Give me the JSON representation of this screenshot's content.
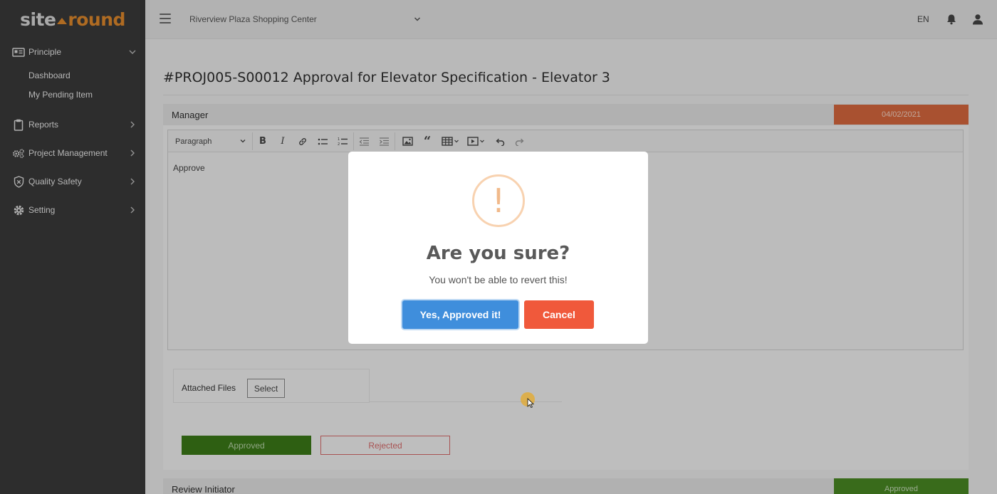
{
  "logo": {
    "part1": "site",
    "part2": "round"
  },
  "sidebar": {
    "principle": "Principle",
    "sub_items": [
      "Dashboard",
      "My Pending Item"
    ],
    "items": [
      {
        "label": "Reports",
        "icon": "clipboard-icon"
      },
      {
        "label": "Project Management",
        "icon": "gears-icon"
      },
      {
        "label": "Quality Safety",
        "icon": "shield-icon"
      },
      {
        "label": "Setting",
        "icon": "gear-icon"
      }
    ]
  },
  "topbar": {
    "project": "Riverview Plaza Shopping Center",
    "language": "EN"
  },
  "main": {
    "title": "#PROJ005-S00012 Approval for Elevator Specification - Elevator 3",
    "card": {
      "header": "Manager",
      "date": "04/02/2021",
      "editor": {
        "block_format": "Paragraph",
        "content": "Approve"
      },
      "attached_files_label": "Attached Files",
      "select_label": "Select",
      "approved_label": "Approved",
      "rejected_label": "Rejected"
    },
    "card2": {
      "header": "Review Initiator",
      "status": "Approved"
    }
  },
  "modal": {
    "icon": "!",
    "title": "Are you sure?",
    "text": "You won't be able to revert this!",
    "confirm": "Yes, Approved it!",
    "cancel": "Cancel"
  },
  "colors": {
    "brand": "#e08a2c",
    "sidebar_bg": "#3a3a3a",
    "date_badge": "#d9683e",
    "approved": "#3c7a18",
    "confirm": "#3f8edc",
    "cancel": "#f0593b"
  }
}
